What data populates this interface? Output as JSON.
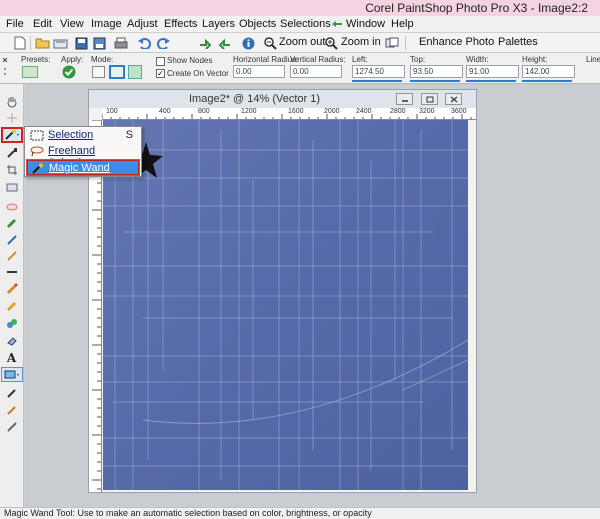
{
  "window": {
    "title": "Corel PaintShop Photo Pro X3 - Image2:2"
  },
  "menu": [
    "File",
    "Edit",
    "View",
    "Image",
    "Adjust",
    "Effects",
    "Layers",
    "Objects",
    "Selections",
    "Window",
    "Help"
  ],
  "toolbar": {
    "zoom_out": "Zoom out",
    "zoom_in": "Zoom in",
    "enhance_photo": "Enhance Photo",
    "palettes": "Palettes"
  },
  "options": {
    "presets_label": "Presets:",
    "apply_label": "Apply:",
    "mode_label": "Mode:",
    "show_nodes": "Show Nodes",
    "create_on_vector": "Create On Vector",
    "horizontal_radius_label": "Horizontal Radius:",
    "horizontal_radius_value": "0.00",
    "vertical_radius_label": "Vertical Radius:",
    "vertical_radius_value": "0.00",
    "left_label": "Left:",
    "left_value": "1274.50",
    "top_label": "Top:",
    "top_value": "93.50",
    "width_label": "Width:",
    "width_value": "91.00",
    "height_label": "Height:",
    "height_value": "142.00",
    "line_label": "Line"
  },
  "document": {
    "title": "Image2* @  14% (Vector 1)",
    "ruler_ticks": [
      "100",
      "400",
      "800",
      "1200",
      "1600",
      "2000",
      "2400",
      "2800",
      "3200",
      "3600"
    ],
    "canvas_color": "#5b6fac"
  },
  "popup_menu": {
    "items": [
      {
        "label": "Selection",
        "shortcut": "S"
      },
      {
        "label": "Freehand Selection",
        "shortcut": ""
      },
      {
        "label": "Magic Wand",
        "shortcut": ""
      }
    ]
  },
  "status": {
    "text": "Magic Wand Tool: Use to make an automatic selection based on color, brightness, or opacity"
  },
  "colors": {
    "accent": "#2a7bd4",
    "highlight_border": "#d3221d",
    "title_bar": "#f4d3e2"
  }
}
